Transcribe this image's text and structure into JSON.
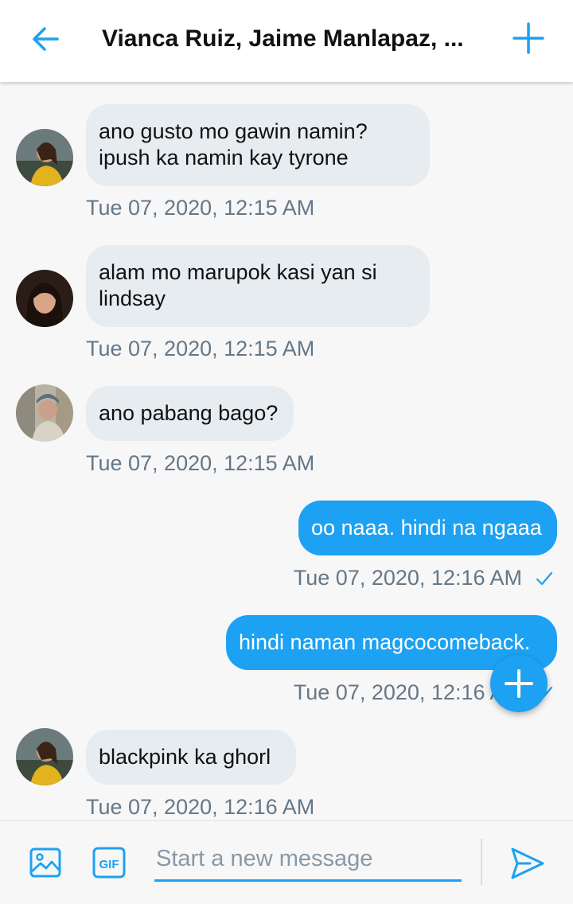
{
  "header": {
    "title": "Vianca Ruiz, Jaime Manlapaz, ...",
    "back_icon": "arrow-left-icon",
    "add_icon": "plus-icon"
  },
  "colors": {
    "accent": "#1da1f2",
    "incoming_bubble": "#e6ecf0",
    "timestamp": "#657786",
    "background": "#f7f7f8"
  },
  "messages": [
    {
      "direction": "incoming",
      "avatar": "avatar-icon",
      "text": "ano gusto mo gawin namin? ipush ka namin kay tyrone",
      "time": "Tue 07, 2020, 12:15 AM"
    },
    {
      "direction": "incoming",
      "avatar": "avatar-icon",
      "text": "alam mo marupok kasi yan si lindsay",
      "time": "Tue 07, 2020, 12:15 AM"
    },
    {
      "direction": "incoming",
      "avatar": "avatar-icon",
      "text": "ano pabang bago?",
      "time": "Tue 07, 2020, 12:15 AM"
    },
    {
      "direction": "outgoing",
      "text": "oo naaa. hindi na ngaaa",
      "time": "Tue 07, 2020, 12:16 AM",
      "status_icon": "checkmark-icon"
    },
    {
      "direction": "outgoing",
      "text": "hindi naman magcocomeback.",
      "time": "Tue 07, 2020, 12:16 AM",
      "status_icon": "checkmark-icon"
    },
    {
      "direction": "incoming",
      "avatar": "avatar-icon",
      "text": "blackpink ka ghorl",
      "time": "Tue 07, 2020, 12:16 AM"
    }
  ],
  "fab": {
    "icon": "plus-icon"
  },
  "composer": {
    "image_icon": "image-icon",
    "gif_label": "GIF",
    "placeholder": "Start a new message",
    "value": "",
    "send_icon": "send-icon"
  }
}
